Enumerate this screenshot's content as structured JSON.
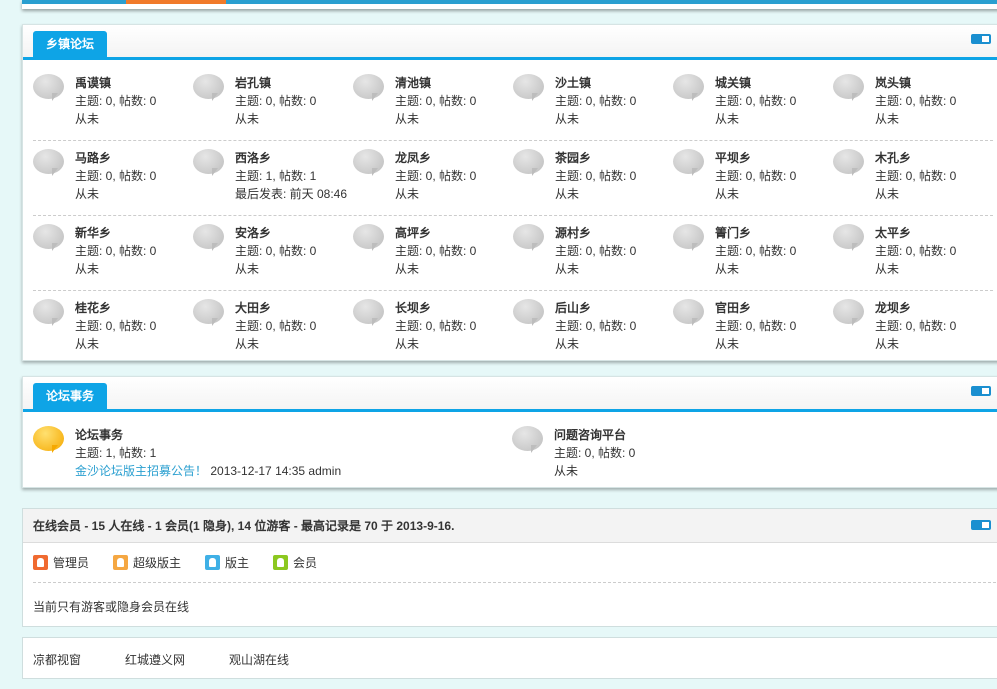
{
  "forum_section": {
    "title": "乡镇论坛",
    "rows": [
      [
        {
          "name": "禹谟镇",
          "stats": "主题: 0, 帖数: 0",
          "last": "从未"
        },
        {
          "name": "岩孔镇",
          "stats": "主题: 0, 帖数: 0",
          "last": "从未"
        },
        {
          "name": "清池镇",
          "stats": "主题: 0, 帖数: 0",
          "last": "从未"
        },
        {
          "name": "沙土镇",
          "stats": "主题: 0, 帖数: 0",
          "last": "从未"
        },
        {
          "name": "城关镇",
          "stats": "主题: 0, 帖数: 0",
          "last": "从未"
        },
        {
          "name": "岚头镇",
          "stats": "主题: 0, 帖数: 0",
          "last": "从未"
        }
      ],
      [
        {
          "name": "马路乡",
          "stats": "主题: 0, 帖数: 0",
          "last": "从未"
        },
        {
          "name": "西洛乡",
          "stats": "主题: 1, 帖数: 1",
          "last": "最后发表: 前天 08:46"
        },
        {
          "name": "龙凤乡",
          "stats": "主题: 0, 帖数: 0",
          "last": "从未"
        },
        {
          "name": "茶园乡",
          "stats": "主题: 0, 帖数: 0",
          "last": "从未"
        },
        {
          "name": "平坝乡",
          "stats": "主题: 0, 帖数: 0",
          "last": "从未"
        },
        {
          "name": "木孔乡",
          "stats": "主题: 0, 帖数: 0",
          "last": "从未"
        }
      ],
      [
        {
          "name": "新华乡",
          "stats": "主题: 0, 帖数: 0",
          "last": "从未"
        },
        {
          "name": "安洛乡",
          "stats": "主题: 0, 帖数: 0",
          "last": "从未"
        },
        {
          "name": "高坪乡",
          "stats": "主题: 0, 帖数: 0",
          "last": "从未"
        },
        {
          "name": "源村乡",
          "stats": "主题: 0, 帖数: 0",
          "last": "从未"
        },
        {
          "name": "箐门乡",
          "stats": "主题: 0, 帖数: 0",
          "last": "从未"
        },
        {
          "name": "太平乡",
          "stats": "主题: 0, 帖数: 0",
          "last": "从未"
        }
      ],
      [
        {
          "name": "桂花乡",
          "stats": "主题: 0, 帖数: 0",
          "last": "从未"
        },
        {
          "name": "大田乡",
          "stats": "主题: 0, 帖数: 0",
          "last": "从未"
        },
        {
          "name": "长坝乡",
          "stats": "主题: 0, 帖数: 0",
          "last": "从未"
        },
        {
          "name": "后山乡",
          "stats": "主题: 0, 帖数: 0",
          "last": "从未"
        },
        {
          "name": "官田乡",
          "stats": "主题: 0, 帖数: 0",
          "last": "从未"
        },
        {
          "name": "龙坝乡",
          "stats": "主题: 0, 帖数: 0",
          "last": "从未"
        }
      ]
    ]
  },
  "affairs_section": {
    "title": "论坛事务",
    "forums": [
      {
        "name": "论坛事务",
        "stats": "主题: 1, 帖数: 1",
        "last_link": "金沙论坛版主招募公告！",
        "last_meta": " 2013-12-17 14:35 admin"
      },
      {
        "name": "问题咨询平台",
        "stats": "主题: 0, 帖数: 0",
        "last": "从未"
      }
    ]
  },
  "online": {
    "title": "在线会员 - 15 人在线 - 1 会员(1 隐身), 14 位游客 - 最高记录是 70 于 2013-9-16.",
    "legend": [
      {
        "label": "管理员",
        "color": "#f06a30"
      },
      {
        "label": "超级版主",
        "color": "#f5a742"
      },
      {
        "label": "版主",
        "color": "#3fb0e6"
      },
      {
        "label": "会员",
        "color": "#8cc820"
      }
    ],
    "note": "当前只有游客或隐身会员在线"
  },
  "links": [
    "凉都视窗",
    "红城遵义网",
    "观山湖在线"
  ]
}
